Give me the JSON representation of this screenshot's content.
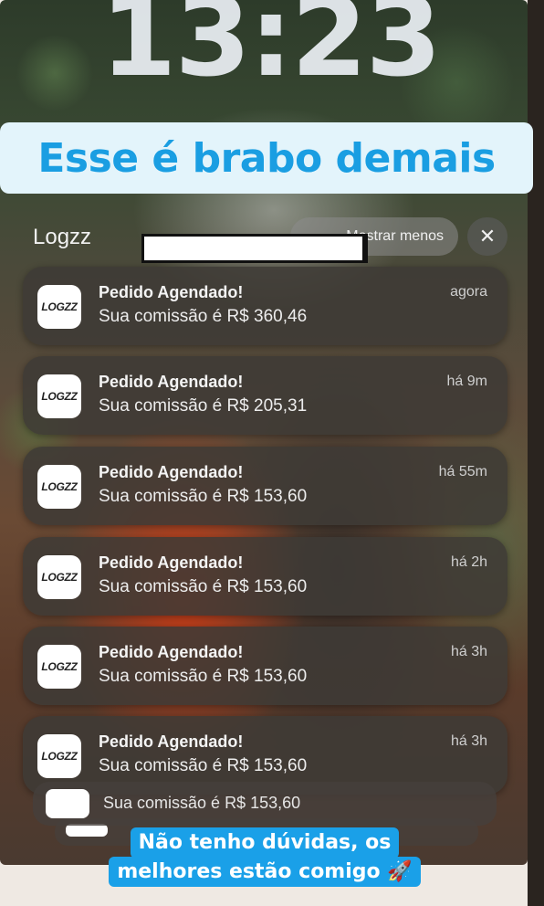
{
  "lock_screen": {
    "time": "13:23"
  },
  "overlay": {
    "headline": "Esse é brabo demais",
    "caption_line1": "Não tenho dúvidas, os",
    "caption_line2": "melhores estão comigo 🚀"
  },
  "notification_group": {
    "app_name": "Logzz",
    "show_less_label": "Mostrar menos",
    "close_icon": "close-icon",
    "app_icon_text": "LOGZZ",
    "notifications": [
      {
        "title": "Pedido Agendado!",
        "body": "Sua comissão é R$ 360,46",
        "time": "agora"
      },
      {
        "title": "Pedido Agendado!",
        "body": "Sua comissão é R$ 205,31",
        "time": "há 9m"
      },
      {
        "title": "Pedido Agendado!",
        "body": "Sua comissão é R$ 153,60",
        "time": "há 55m"
      },
      {
        "title": "Pedido Agendado!",
        "body": "Sua comissão é R$ 153,60",
        "time": "há 2h"
      },
      {
        "title": "Pedido Agendado!",
        "body": "Sua comissão é R$ 153,60",
        "time": "há 3h"
      },
      {
        "title": "Pedido Agendado!",
        "body": "Sua comissão é R$ 153,60",
        "time": "há 3h"
      }
    ],
    "stacked_peek_body": "Sua comissão é R$ 153,60"
  }
}
